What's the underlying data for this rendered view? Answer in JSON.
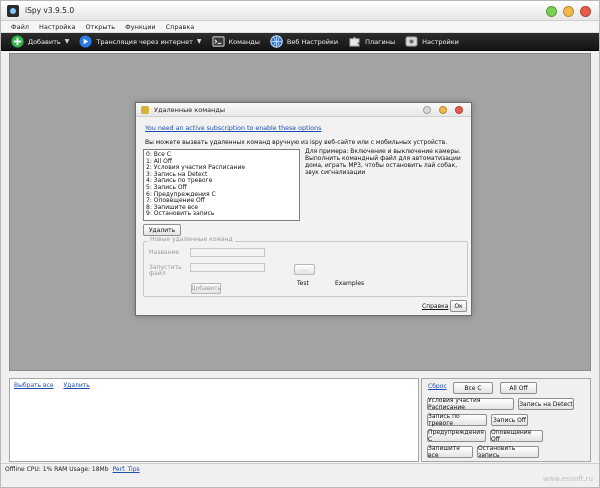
{
  "window": {
    "title": "iSpy v3.9.5.0"
  },
  "menubar": {
    "items": [
      "Файл",
      "Настройка",
      "Открыть",
      "Функции",
      "Справка"
    ]
  },
  "toolbar": {
    "items": [
      {
        "label": "Добавить",
        "icon": "plus-icon",
        "has_dropdown": true
      },
      {
        "label": "Трансляция через интернет",
        "icon": "play-icon",
        "has_dropdown": true
      },
      {
        "label": "Команды",
        "icon": "terminal-icon",
        "has_dropdown": false
      },
      {
        "label": "Веб Настройки",
        "icon": "globe-icon",
        "has_dropdown": false
      },
      {
        "label": "Плагины",
        "icon": "puzzle-icon",
        "has_dropdown": false
      },
      {
        "label": "Настройки",
        "icon": "settings-icon",
        "has_dropdown": false
      }
    ]
  },
  "dialog": {
    "title": "Удаленные команды",
    "subscription_link": "You need an active subscription to enable these options",
    "description": "Вы можете вызвать удаленных команд вручную из ispy веб-сайте или с мобильных устройств.",
    "commands": [
      "0: Все С",
      "1: All Off",
      "2: Условия участия Расписание",
      "3: Запись на Detect",
      "4: Запись по тревоге",
      "5: Запись Off",
      "6: Предупреждения С",
      "7: Оповещение Off",
      "8: Запишите все",
      "9: Остановить запись"
    ],
    "example_text": "Для примера: Включение и выключение камеры. Выполнить командный файл для автоматизации дома, играть MP3, чтобы остановить лай собак, звук сигнализации",
    "delete_button": "Удалить",
    "new_group_legend": "Новые удаленные команд",
    "name_label": "Название",
    "execute_label": "Запустить",
    "file_label": "файл",
    "add_button": "Добавить",
    "browse_button": "...",
    "test_label": "Test",
    "examples_label": "Examples",
    "help_link": "Справка",
    "ok_button": "Ок"
  },
  "bottom_left": {
    "select_all": "Выбрать все",
    "delete": "Удалить"
  },
  "bottom_right": {
    "reset_link": "Сброс",
    "buttons": [
      "Все С",
      "All Off",
      "Условия участия Расписание",
      "Запись на Detect",
      "Запись по тревоге",
      "Запись Off",
      "Предупреждения С",
      "Оповещение Off",
      "Запишите все",
      "Остановить запись"
    ]
  },
  "statusbar": {
    "text": "Offline  CPU: 1% RAM Usage: 18Mb",
    "perf_link": "Perf. Tips"
  },
  "watermark": "www.ensoft.ru"
}
